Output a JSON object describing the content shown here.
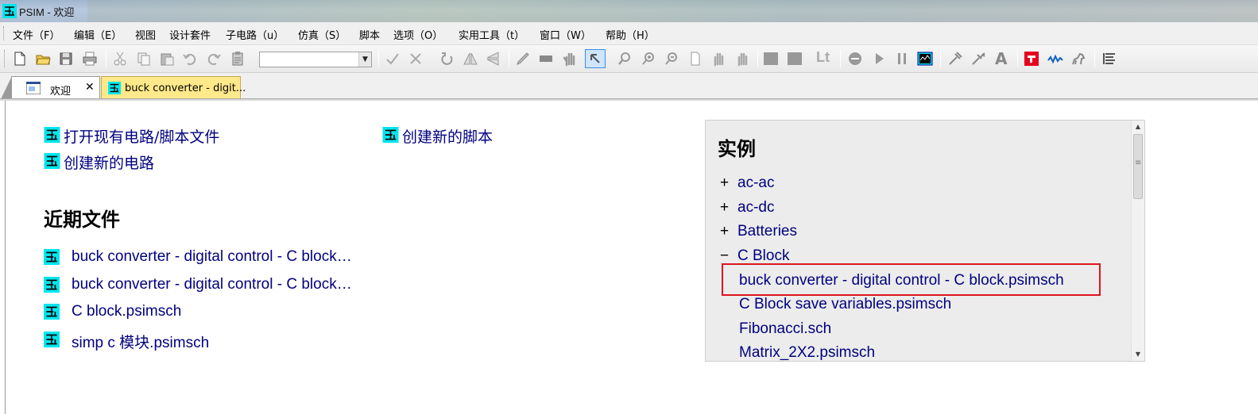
{
  "window": {
    "title": "PSIM - 欢迎",
    "icon": "psim-app-icon"
  },
  "menu": [
    {
      "label": "文件（F）"
    },
    {
      "label": "编辑（E）"
    },
    {
      "label": "视图"
    },
    {
      "label": "设计套件"
    },
    {
      "label": "子电路（u）"
    },
    {
      "label": "仿真（S）"
    },
    {
      "label": "脚本"
    },
    {
      "label": "选项（O）"
    },
    {
      "label": "实用工具（t）"
    },
    {
      "label": "窗口（W）"
    },
    {
      "label": "帮助（H）"
    }
  ],
  "toolbar": {
    "combo_value": "",
    "text_button": "Lt"
  },
  "tabs": [
    {
      "label": "欢迎",
      "close": "✕",
      "active": true
    },
    {
      "label": "buck converter - digit...",
      "active": false,
      "color": "#ffe98a"
    }
  ],
  "welcome": {
    "open_existing": "打开现有电路/脚本文件",
    "create_circuit": "创建新的电路",
    "create_script": "创建新的脚本",
    "recent_heading": "近期文件",
    "recent_files": [
      "buck converter - digital control - C block…",
      "buck converter - digital control - C block…",
      "C block.psimsch",
      "simp c 模块.psimsch"
    ]
  },
  "examples": {
    "heading": "实例",
    "folders": [
      {
        "sign": "+",
        "name": "ac-ac"
      },
      {
        "sign": "+",
        "name": "ac-dc"
      },
      {
        "sign": "+",
        "name": "Batteries"
      },
      {
        "sign": "−",
        "name": "C Block"
      }
    ],
    "files": [
      "buck converter - digital control - C block.psimsch",
      "C Block save variables.psimsch",
      "Fibonacci.sch",
      "Matrix_2X2.psimsch"
    ],
    "highlight_color": "#e0141e"
  },
  "colors": {
    "link": "#000080",
    "icon_cyan": "#00e5ee"
  }
}
